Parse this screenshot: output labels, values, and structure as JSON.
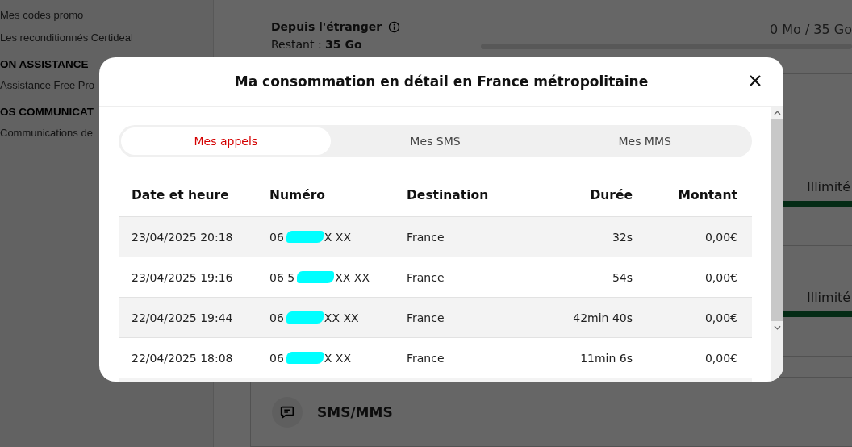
{
  "sidebar": {
    "items": [
      {
        "kind": "link",
        "label": "Mes codes promo"
      },
      {
        "kind": "link",
        "label": "Les reconditionnés Certideal"
      },
      {
        "kind": "heading",
        "label": "ON ASSISTANCE"
      },
      {
        "kind": "link",
        "label": "Assistance Free Pro"
      },
      {
        "kind": "heading",
        "label": "OS COMMUNICAT"
      },
      {
        "kind": "link",
        "label": "Communications de"
      }
    ]
  },
  "main": {
    "roaming": {
      "title": "Depuis l'étranger",
      "remaining": "Restant : **35 Go**",
      "usage": "0 Mo / 35 Go",
      "level": 0
    },
    "allowances": [
      {
        "label": "Illimité",
        "level": 1
      },
      {
        "label": "Illimité",
        "level": 1
      }
    ],
    "sms_card": {
      "title": "SMS/MMS"
    }
  },
  "modal": {
    "title": "Ma consommation en détail en France métropolitaine",
    "tabs": [
      {
        "label": "Mes appels",
        "selected": true
      },
      {
        "label": "Mes SMS",
        "selected": false
      },
      {
        "label": "Mes MMS",
        "selected": false
      }
    ],
    "table": {
      "columns": [
        "Date et heure",
        "Numéro",
        "Destination",
        "Durée",
        "Montant"
      ],
      "rows": [
        {
          "date": "23/04/2025 20:18",
          "number_start": "06",
          "redacted": true,
          "number_end": "X XX",
          "destination": "France",
          "duration": "32s",
          "amount": "0,00€"
        },
        {
          "date": "23/04/2025 19:16",
          "number_start": "06 5",
          "redacted": true,
          "number_end": "XX XX",
          "destination": "France",
          "duration": "54s",
          "amount": "0,00€"
        },
        {
          "date": "22/04/2025 19:44",
          "number_start": "06",
          "redacted": true,
          "number_end": "XX XX",
          "destination": "France",
          "duration": "42min 40s",
          "amount": "0,00€"
        },
        {
          "date": "22/04/2025 18:08",
          "number_start": "06",
          "redacted": true,
          "number_end": "X XX",
          "destination": "France",
          "duration": "11min 6s",
          "amount": "0,00€"
        }
      ]
    }
  }
}
